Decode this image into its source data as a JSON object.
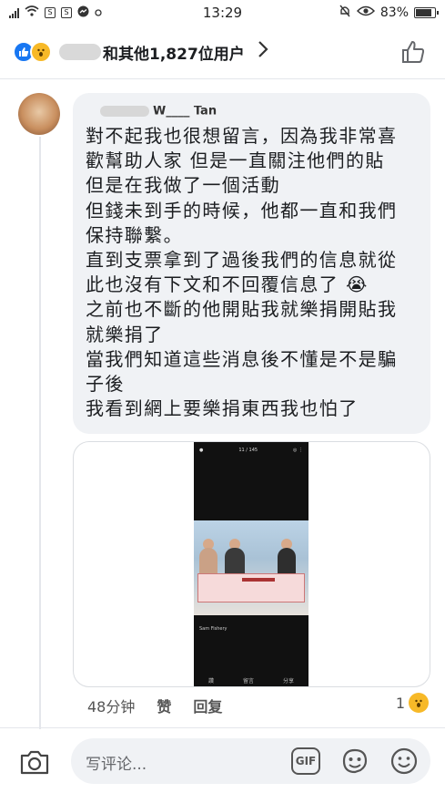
{
  "status_bar": {
    "signal": ".ıll",
    "carrier_icons": [
      "wifi-icon",
      "s-icon",
      "s-icon",
      "messenger-icon",
      "dot-icon"
    ],
    "time": "13:29",
    "battery_percent": "83%",
    "icons_right": [
      "alarm-off-icon",
      "eye-icon",
      "battery-icon"
    ]
  },
  "reactions": {
    "summary_text": "和其他1,827位用户",
    "like_glyph": "👍",
    "wow_glyph": "😮"
  },
  "comment": {
    "author": "W____ Tan",
    "lines": [
      "對不起我也很想留言，因為我非常喜",
      "歡幫助人家 但是一直關注他們的貼",
      "但是在我做了一個活動",
      "但錢未到手的時候，他都一直和我們",
      "保持聯繫。",
      "直到支票拿到了過後我們的信息就從",
      "此也沒有下文和不回覆信息了 😭",
      "之前也不斷的他開貼我就樂捐開貼我",
      "就樂捐了",
      "當我們知道這些消息後不懂是不是騙",
      "子後",
      "我看到網上要樂捐東西我也怕了"
    ],
    "attachment": {
      "counter": "11 / 145",
      "caption_name": "Sam Fishery",
      "bottom_like": "讚",
      "bottom_comment": "留言",
      "bottom_share": "分享"
    },
    "time_ago": "48分钟",
    "like_label": "赞",
    "reply_label": "回复",
    "reaction_count": "1",
    "reaction_glyph": "😮"
  },
  "composer": {
    "placeholder": "写评论...",
    "gif_label": "GIF"
  }
}
